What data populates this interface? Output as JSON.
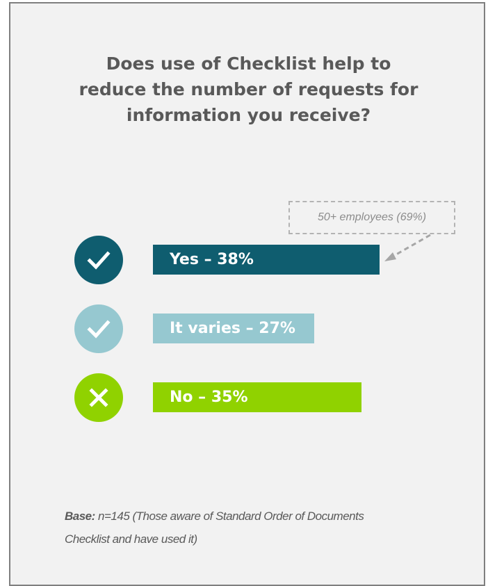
{
  "title_lines": [
    "Does use of Checklist help to",
    "reduce the number of requests for",
    "information you receive?"
  ],
  "chart_data": {
    "type": "bar",
    "categories": [
      "Yes",
      "It varies",
      "No"
    ],
    "values": [
      38,
      27,
      35
    ],
    "value_unit": "%",
    "labels": [
      "Yes – 38%",
      "It varies – 27%",
      "No – 35%"
    ],
    "colors": [
      "#0f5d6f",
      "#96c8d0",
      "#90d200"
    ],
    "icons": [
      "check-icon",
      "check-icon",
      "x-icon"
    ],
    "annotation": {
      "text": "50+ employees (69%)",
      "target": "Yes"
    }
  },
  "footnote": {
    "label": "Base:",
    "text": "n=145 (Those aware of Standard Order of Documents Checklist and have used it)"
  }
}
